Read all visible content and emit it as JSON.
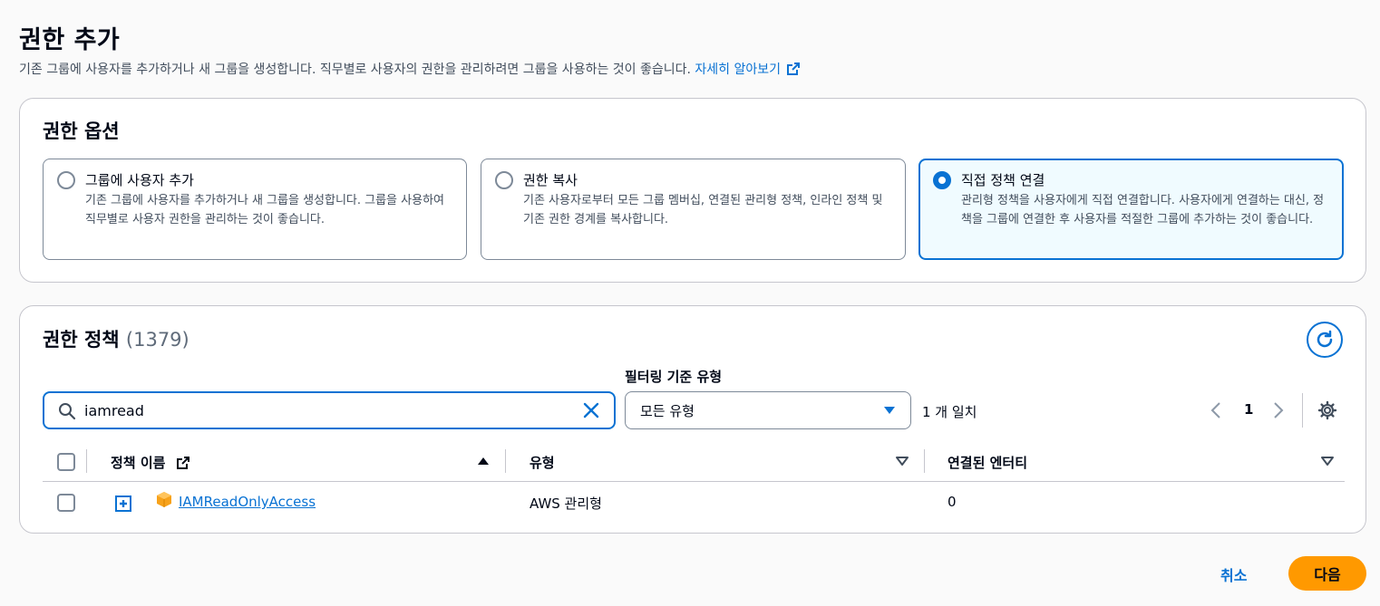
{
  "header": {
    "title": "권한 추가",
    "description": "기존 그룹에 사용자를 추가하거나 새 그룹을 생성합니다. 직무별로 사용자의 권한을 관리하려면 그룹을 사용하는 것이 좋습니다.",
    "learn_more": "자세히 알아보기"
  },
  "permission_options": {
    "title": "권한 옵션",
    "options": [
      {
        "title": "그룹에 사용자 추가",
        "description": "기존 그룹에 사용자를 추가하거나 새 그룹을 생성합니다. 그룹을 사용하여 직무별로 사용자 권한을 관리하는 것이 좋습니다.",
        "selected": false
      },
      {
        "title": "권한 복사",
        "description": "기존 사용자로부터 모든 그룹 멤버십, 연결된 관리형 정책, 인라인 정책 및 기존 권한 경계를 복사합니다.",
        "selected": false
      },
      {
        "title": "직접 정책 연결",
        "description": "관리형 정책을 사용자에게 직접 연결합니다. 사용자에게 연결하는 대신, 정책을 그룹에 연결한 후 사용자를 적절한 그룹에 추가하는 것이 좋습니다.",
        "selected": true
      }
    ]
  },
  "policies": {
    "title": "권한 정책",
    "count": "(1379)",
    "search_value": "iamread",
    "filter_label": "필터링 기준 유형",
    "filter_value": "모든 유형",
    "match_count": "1 개 일치",
    "page": "1",
    "columns": {
      "name": "정책 이름",
      "type": "유형",
      "entities": "연결된 엔터티"
    },
    "rows": [
      {
        "name": "IAMReadOnlyAccess",
        "type": "AWS 관리형",
        "entities": "0"
      }
    ]
  },
  "footer": {
    "cancel": "취소",
    "next": "다음"
  },
  "colors": {
    "accent": "#0972d3",
    "primary_button": "#ff9900",
    "selected_tile_bg": "#f0fbff"
  }
}
